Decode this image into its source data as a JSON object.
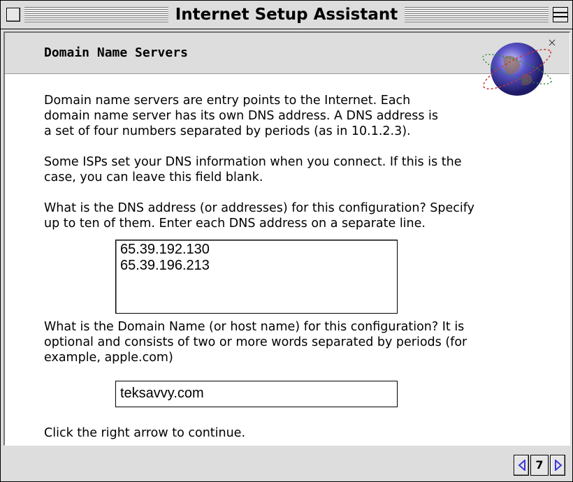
{
  "window": {
    "title": "Internet Setup Assistant"
  },
  "header": {
    "title": "Domain Name Servers",
    "icon": "globe-icon"
  },
  "body": {
    "para1": "Domain name servers are entry points to the Internet.  Each\ndomain name server has its own DNS address. A DNS address is\na set of four numbers separated by periods (as in 10.1.2.3).",
    "para2": "Some ISPs set your DNS information when you connect.  If this is the\ncase, you can leave this field blank.",
    "para3": "What is the DNS address (or addresses) for this configuration?  Specify\nup to ten of them.  Enter each DNS address on a separate line.",
    "dns_value": "65.39.192.130\n65.39.196.213",
    "para4": "What is the Domain Name (or host name) for this configuration?  It is\noptional and consists of two or more words separated by periods (for\nexample, apple.com)",
    "domain_value": "teksavvy.com",
    "para5": "Click the right arrow to continue."
  },
  "nav": {
    "page": "7",
    "prev_icon": "left-arrow-icon",
    "next_icon": "right-arrow-icon",
    "arrow_color": "#3b3bdb"
  }
}
